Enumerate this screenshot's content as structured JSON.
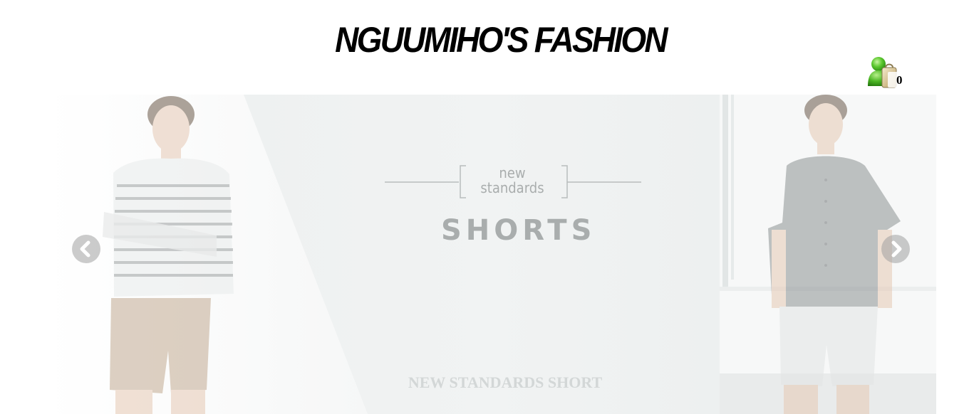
{
  "header": {
    "brand_title": "NGUUMIHO'S FASHION"
  },
  "cart": {
    "icon": "user-cart-icon",
    "count": "0"
  },
  "slider": {
    "slide": {
      "subheading_line1": "new",
      "subheading_line2": "standards",
      "heading": "SHORTS",
      "caption": "NEW STANDARDS SHORT"
    },
    "prev_icon": "chevron-left-icon",
    "next_icon": "chevron-right-icon"
  },
  "colors": {
    "slide_background": "#eef1f1",
    "caption": "#d3d7d7",
    "heading_text": "#a9adad",
    "cart_green": "#5cc82e"
  }
}
